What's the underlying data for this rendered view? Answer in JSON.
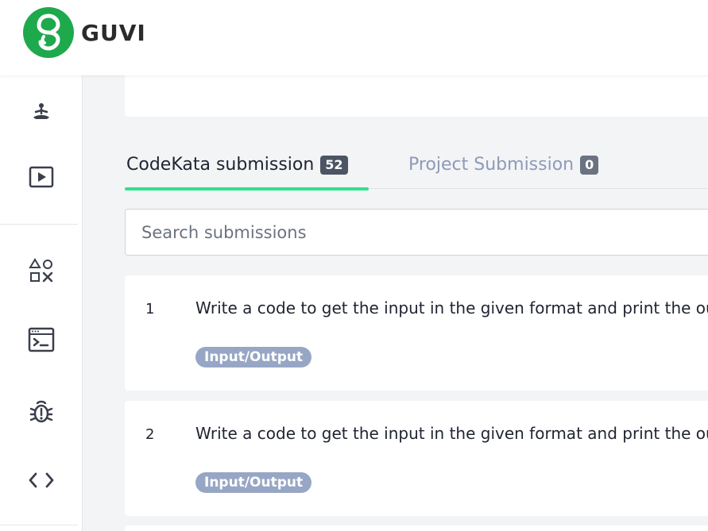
{
  "header": {
    "brand": "GUVI"
  },
  "sidebar": {
    "items": [
      {
        "icon": "meditation-icon"
      },
      {
        "icon": "video-play-icon"
      },
      {
        "icon": "shapes-icon"
      },
      {
        "icon": "terminal-window-icon"
      },
      {
        "icon": "bug-icon"
      },
      {
        "icon": "code-brackets-icon"
      }
    ]
  },
  "tabs": [
    {
      "label": "CodeKata submission",
      "count": "52",
      "active": true
    },
    {
      "label": "Project Submission",
      "count": "0",
      "active": false
    }
  ],
  "search": {
    "placeholder": "Search submissions"
  },
  "submissions": [
    {
      "number": "1",
      "title": "Write a code to get the input in the given format and print the ou",
      "tag": "Input/Output"
    },
    {
      "number": "2",
      "title": "Write a code to get the input in the given format and print the ou",
      "tag": "Input/Output"
    }
  ],
  "colors": {
    "brand_green": "#1ea94c",
    "active_tab_underline": "#2de38a",
    "tag_bg": "#97a6c4",
    "inactive_tab_text": "#8f9ab8"
  }
}
